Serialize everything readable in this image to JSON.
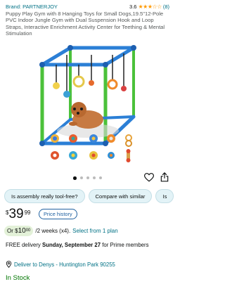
{
  "brand": "Brand: PARTNERJOY",
  "rating": {
    "value": "3.6",
    "stars": "★★★☆☆",
    "count": "(8)"
  },
  "title": "Puppy Play Gym with 8 Hanging Toys for Small Dogs,19.5\"12-Pole PVC Indoor Jungle Gym with Dual Suspension Hook and Loop Straps, Interactive Enrichment Activity Center for Teething & Mental Stimulation",
  "chips": [
    "Is assembly really tool-free?",
    "Compare with similar",
    "Is"
  ],
  "price": {
    "currency": "$",
    "whole": "39",
    "fraction": "99"
  },
  "price_history_label": "Price history",
  "installment": {
    "prefix": "Or $",
    "amount": "10",
    "cents": "00",
    "rest": "/2 weeks (x4).",
    "link": "Select from 1 plan"
  },
  "delivery": {
    "prefix": "FREE delivery ",
    "date": "Sunday, September 27",
    "suffix": " for Prime members"
  },
  "location": "Deliver to Denys - Huntington Park 90255",
  "stock": "In Stock",
  "colors": {
    "link": "#007185",
    "instock": "#007600",
    "star": "#ff9900"
  }
}
